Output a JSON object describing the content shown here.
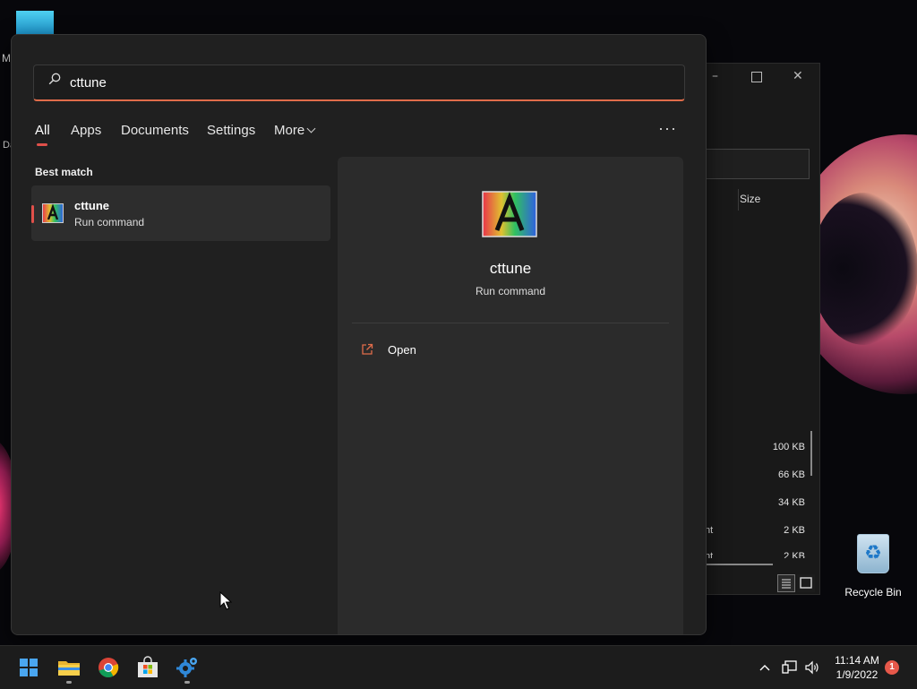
{
  "desktop": {
    "label_m": "M",
    "label_d": "Da",
    "recycle_bin": "Recycle Bin"
  },
  "explorer": {
    "size_header": "Size",
    "sizes": [
      "100 KB",
      "66 KB",
      "34 KB",
      "2 KB",
      "2 KB"
    ],
    "name_fragments": [
      "nt",
      "nt"
    ]
  },
  "search": {
    "query": "cttune",
    "icon": "search-icon",
    "tabs": [
      {
        "label": "All",
        "active": true
      },
      {
        "label": "Apps"
      },
      {
        "label": "Documents"
      },
      {
        "label": "Settings"
      },
      {
        "label": "More"
      }
    ],
    "more_options": "···",
    "best_match_label": "Best match",
    "accent_color": "#e0504a"
  },
  "result": {
    "title": "cttune",
    "subtitle": "Run command",
    "icon": "cleartype-tuner-icon"
  },
  "detail": {
    "title": "cttune",
    "subtitle": "Run command",
    "actions": [
      {
        "label": "Open",
        "icon": "open-external-icon"
      }
    ]
  },
  "taskbar": {
    "apps": [
      "start",
      "file-explorer",
      "chrome",
      "microsoft-store",
      "cttune"
    ],
    "time": "11:14 AM",
    "date": "1/9/2022",
    "notifications": "1"
  }
}
